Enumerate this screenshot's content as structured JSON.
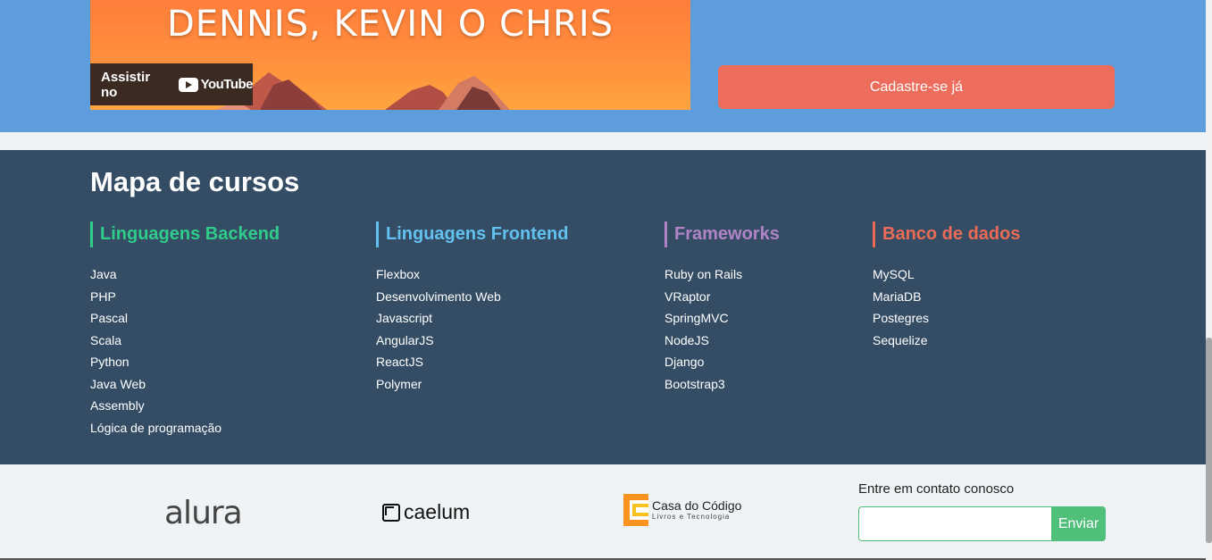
{
  "hero": {
    "video_title": "DENNIS, KEVIN O CHRIS",
    "youtube_button": {
      "label": "Assistir no",
      "brand": "YouTube"
    },
    "cta_label": "Cadastre-se já"
  },
  "map": {
    "title": "Mapa de cursos",
    "columns": [
      {
        "title": "Linguagens Backend",
        "color": "#2fcc8a",
        "items": [
          "Java",
          "PHP",
          "Pascal",
          "Scala",
          "Python",
          "Java Web",
          "Assembly",
          "Lógica de programação"
        ]
      },
      {
        "title": "Linguagens Frontend",
        "color": "#62c1ef",
        "items": [
          "Flexbox",
          "Desenvolvimento Web",
          "Javascript",
          "AngularJS",
          "ReactJS",
          "Polymer"
        ]
      },
      {
        "title": "Frameworks",
        "color": "#b084c6",
        "items": [
          "Ruby on Rails",
          "VRaptor",
          "SpringMVC",
          "NodeJS",
          "Django",
          "Bootstrap3"
        ]
      },
      {
        "title": "Banco de dados",
        "color": "#eb6b56",
        "items": [
          "MySQL",
          "MariaDB",
          "Postegres",
          "Sequelize"
        ]
      }
    ]
  },
  "footer": {
    "logos": {
      "alura": "alura",
      "caelum": "caelum",
      "casa_do_codigo": "Casa do Código",
      "casa_do_codigo_sub": "Livros e Tecnologia"
    },
    "contact_label": "Entre em contato conosco",
    "contact_placeholder": "",
    "send_label": "Enviar"
  }
}
